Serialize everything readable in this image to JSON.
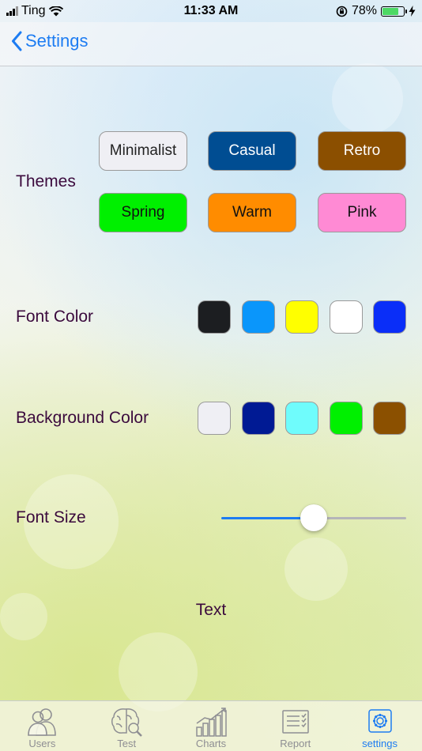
{
  "status_bar": {
    "carrier": "Ting",
    "time": "11:33 AM",
    "battery": "78%",
    "battery_level": 0.78
  },
  "nav": {
    "back_label": "Settings"
  },
  "themes": {
    "label": "Themes",
    "buttons": [
      {
        "label": "Minimalist",
        "bg": "#efeff4",
        "fg": "#222222"
      },
      {
        "label": "Casual",
        "bg": "#004d92",
        "fg": "#ffffff"
      },
      {
        "label": "Retro",
        "bg": "#8b4f00",
        "fg": "#ffffff"
      },
      {
        "label": "Spring",
        "bg": "#00f000",
        "fg": "#111111"
      },
      {
        "label": "Warm",
        "bg": "#ff8c00",
        "fg": "#111111"
      },
      {
        "label": "Pink",
        "bg": "#ff8ad4",
        "fg": "#111111"
      }
    ]
  },
  "font_color": {
    "label": "Font Color",
    "swatches": [
      "#1c1e21",
      "#0a96fb",
      "#ffff00",
      "#ffffff",
      "#0a2ef8"
    ]
  },
  "background_color": {
    "label": "Background Color",
    "swatches": [
      "#efeff4",
      "#001a94",
      "#6ffcfc",
      "#00f000",
      "#8b5000"
    ]
  },
  "font_size": {
    "label": "Font Size",
    "value": 0.5
  },
  "preview": {
    "text": "Text"
  },
  "tabs": [
    {
      "label": "Users",
      "icon": "users-icon",
      "active": false
    },
    {
      "label": "Test",
      "icon": "brain-icon",
      "active": false
    },
    {
      "label": "Charts",
      "icon": "bar-chart-icon",
      "active": false
    },
    {
      "label": "Report",
      "icon": "report-icon",
      "active": false
    },
    {
      "label": "settings",
      "icon": "gear-icon",
      "active": true
    }
  ],
  "colors": {
    "accent": "#1d7cf2",
    "label_text": "#3b0a3d",
    "inactive_tab": "#8e8e93"
  }
}
